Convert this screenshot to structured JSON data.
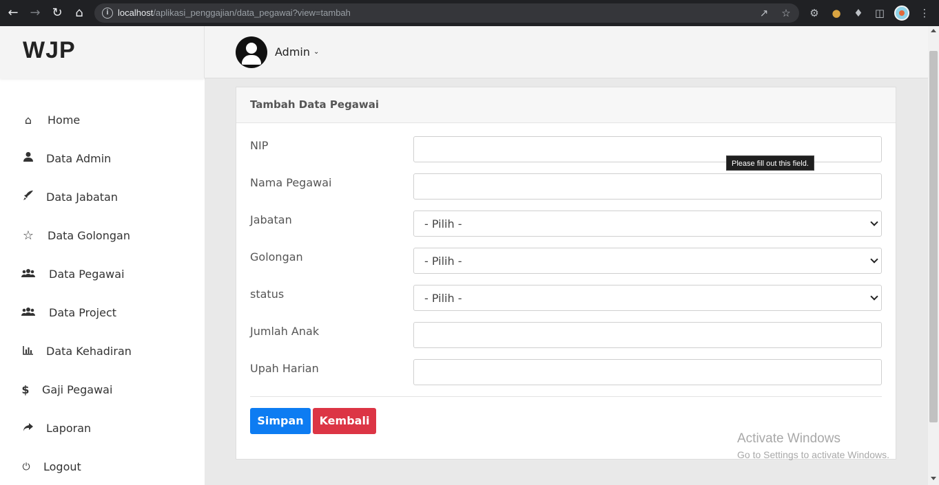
{
  "browser": {
    "url_host": "localhost",
    "url_path": "/aplikasi_penggajian/data_pegawai?view=tambah"
  },
  "sidebar": {
    "brand": "WJP",
    "items": [
      {
        "label": "Home",
        "icon": "home-icon"
      },
      {
        "label": "Data Admin",
        "icon": "user-icon"
      },
      {
        "label": "Data Jabatan",
        "icon": "rocket-icon"
      },
      {
        "label": "Data Golongan",
        "icon": "star-icon"
      },
      {
        "label": "Data Pegawai",
        "icon": "users-icon"
      },
      {
        "label": "Data Project",
        "icon": "users-icon"
      },
      {
        "label": "Data Kehadiran",
        "icon": "bar-chart-icon"
      },
      {
        "label": "Gaji Pegawai",
        "icon": "dollar-icon"
      },
      {
        "label": "Laporan",
        "icon": "share-icon"
      },
      {
        "label": "Logout",
        "icon": "power-icon"
      }
    ]
  },
  "topbar": {
    "user_name": "Admin"
  },
  "form": {
    "title": "Tambah Data Pegawai",
    "fields": [
      {
        "label": "NIP",
        "type": "text",
        "value": ""
      },
      {
        "label": "Nama Pegawai",
        "type": "text",
        "value": ""
      },
      {
        "label": "Jabatan",
        "type": "select",
        "value": "- Pilih -"
      },
      {
        "label": "Golongan",
        "type": "select",
        "value": "- Pilih -"
      },
      {
        "label": "status",
        "type": "select",
        "value": "- Pilih -"
      },
      {
        "label": "Jumlah Anak",
        "type": "text",
        "value": ""
      },
      {
        "label": "Upah Harian",
        "type": "text",
        "value": ""
      }
    ],
    "save_label": "Simpan",
    "back_label": "Kembali"
  },
  "tooltip": "Please fill out this field.",
  "watermark": {
    "title": "Activate Windows",
    "subtitle": "Go to Settings to activate Windows."
  },
  "colors": {
    "primary": "#0d7cf2",
    "danger": "#dc3545",
    "browser_bar": "#202124"
  }
}
